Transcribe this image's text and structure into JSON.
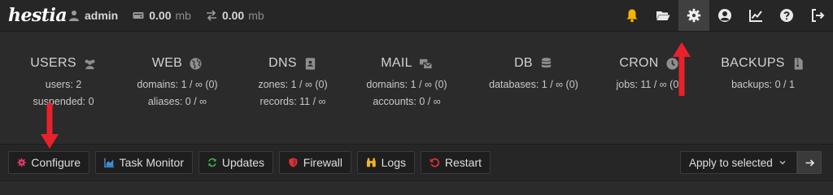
{
  "brand": {
    "logo_text": "hestia"
  },
  "topbar": {
    "user": "admin",
    "disk": {
      "value": "0.00",
      "unit": "mb"
    },
    "bandwidth": {
      "value": "0.00",
      "unit": "mb"
    },
    "icons": [
      "bell-icon",
      "folder-open-icon",
      "gear-icon",
      "user-circle-icon",
      "chart-line-icon",
      "help-icon",
      "logout-icon"
    ],
    "active_icon": "gear-icon"
  },
  "summary": {
    "users": {
      "title": "USERS",
      "lines": [
        "users: 2",
        "suspended: 0"
      ]
    },
    "web": {
      "title": "WEB",
      "lines": [
        "domains: 1 / ∞ (0)",
        "aliases: 0 / ∞"
      ]
    },
    "dns": {
      "title": "DNS",
      "lines": [
        "zones: 1 / ∞ (0)",
        "records: 11 / ∞"
      ]
    },
    "mail": {
      "title": "MAIL",
      "lines": [
        "domains: 1 / ∞ (0)",
        "accounts: 0 / ∞"
      ]
    },
    "db": {
      "title": "DB",
      "lines": [
        "databases: 1 / ∞ (0)"
      ]
    },
    "cron": {
      "title": "CRON",
      "lines": [
        "jobs: 11 / ∞ (0)"
      ]
    },
    "backups": {
      "title": "BACKUPS",
      "lines": [
        "backups: 0 / 1"
      ]
    }
  },
  "toolbar": {
    "configure": "Configure",
    "task_monitor": "Task Monitor",
    "updates": "Updates",
    "firewall": "Firewall",
    "logs": "Logs",
    "restart": "Restart",
    "bulk_action": "Apply to selected"
  },
  "colors": {
    "accent_red": "#e8212d",
    "configure_icon": "#e23b6a",
    "task_monitor_icon": "#3b8fd6",
    "updates_icon": "#3cb34a",
    "firewall_icon": "#e0303a",
    "logs_icon": "#f0b429",
    "restart_icon": "#e0303a",
    "bell_icon": "#f5b400",
    "folder_icon": "#f0c14b"
  }
}
